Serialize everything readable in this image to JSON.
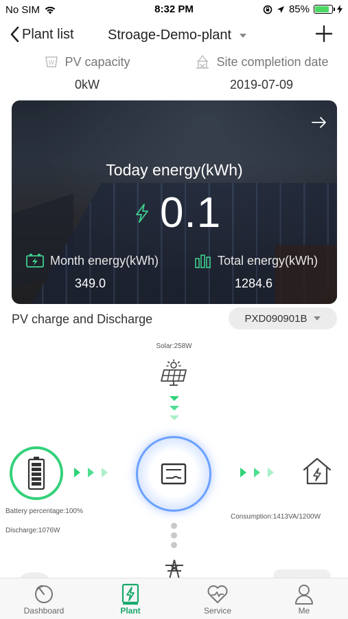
{
  "status_bar": {
    "carrier": "No SIM",
    "time": "8:32 PM",
    "battery_percent": "85%",
    "battery_level": 0.85,
    "icons": [
      "wifi-icon",
      "lock-rotation-icon",
      "location-arrow-icon",
      "charging-bolt-icon"
    ]
  },
  "nav": {
    "back_label": "Plant list",
    "title": "Stroage-Demo-plant",
    "add_icon": "plus-icon"
  },
  "info": {
    "pv_capacity_label": "PV capacity",
    "pv_capacity_value": "0kW",
    "completion_label": "Site completion date",
    "completion_value": "2019-07-09"
  },
  "energy_card": {
    "today_label": "Today energy(kWh)",
    "today_value": "0.1",
    "month_label": "Month energy(kWh)",
    "month_value": "349.0",
    "total_label": "Total energy(kWh)",
    "total_value": "1284.6"
  },
  "section": {
    "title": "PV charge and Discharge",
    "device": "PXD090901B"
  },
  "flow": {
    "solar": "Solar:258W",
    "battery_percentage": "Battery percentage:100%",
    "discharge": "Discharge:1076W",
    "consumption": "Consumption:1413VA/1200W",
    "accent_green": "#34d17a",
    "inverter_blue": "#6aa0ff"
  },
  "tabs": [
    {
      "label": "Dashboard",
      "icon": "dashboard-gauge-icon"
    },
    {
      "label": "Plant",
      "icon": "plant-bolt-icon"
    },
    {
      "label": "Service",
      "icon": "service-heart-icon"
    },
    {
      "label": "Me",
      "icon": "user-icon"
    }
  ],
  "colors": {
    "active_tab": "#18a86b",
    "card_text": "#ffffff"
  }
}
